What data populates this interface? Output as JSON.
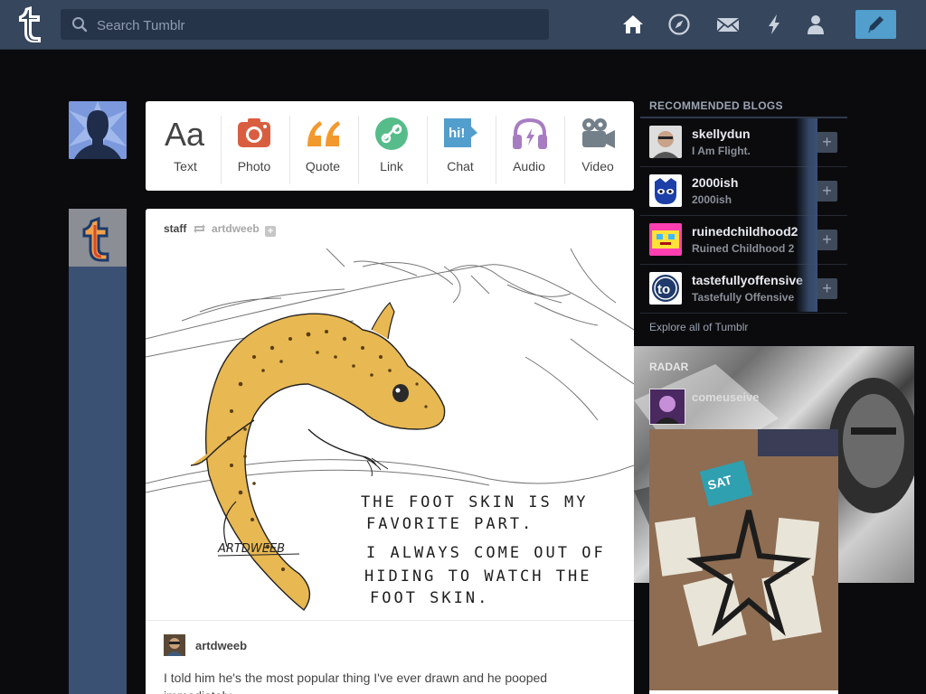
{
  "search": {
    "placeholder": "Search Tumblr"
  },
  "nav": {
    "icons": [
      "home-icon",
      "explore-icon",
      "inbox-icon",
      "activity-icon",
      "account-icon",
      "compose-icon"
    ]
  },
  "post_types": [
    {
      "label": "Text",
      "icon": "text-icon",
      "color": "#444444"
    },
    {
      "label": "Photo",
      "icon": "camera-icon",
      "color": "#d95e40"
    },
    {
      "label": "Quote",
      "icon": "quote-icon",
      "color": "#f2992e"
    },
    {
      "label": "Link",
      "icon": "link-icon",
      "color": "#56bc8a"
    },
    {
      "label": "Chat",
      "icon": "chat-icon",
      "color": "#529ecc"
    },
    {
      "label": "Audio",
      "icon": "headphones-icon",
      "color": "#a77dc2"
    },
    {
      "label": "Video",
      "icon": "video-camera-icon",
      "color": "#748089"
    }
  ],
  "post": {
    "author": "staff",
    "reblogged_from": "artdweeb",
    "image": {
      "signature": "ARTDWEEB",
      "handwriting": [
        "THE FOOT SKIN IS MY",
        "FAVORITE PART.",
        "I ALWAYS COME OUT OF",
        "HIDING TO WATCH THE",
        "FOOT SKIN."
      ]
    },
    "caption_user": "artdweeb",
    "caption_text": "I told him he's the most popular thing I've ever drawn and he pooped immediately."
  },
  "sidebar": {
    "title": "RECOMMENDED BLOGS",
    "blogs": [
      {
        "name": "skellydun",
        "title": "I Am Flight."
      },
      {
        "name": "2000ish",
        "title": "2000ish"
      },
      {
        "name": "ruinedchildhood2",
        "title": "Ruined Childhood 2"
      },
      {
        "name": "tastefullyoffensive",
        "title": "Tastefully Offensive"
      }
    ],
    "follow_label": "+",
    "explore": "Explore all of Tumblr",
    "radar_title": "RADAR",
    "radar_blog": "comeuseive"
  },
  "colors": {
    "topbar": "#36465d",
    "background": "#0b0b0e",
    "compose": "#529ecc"
  }
}
